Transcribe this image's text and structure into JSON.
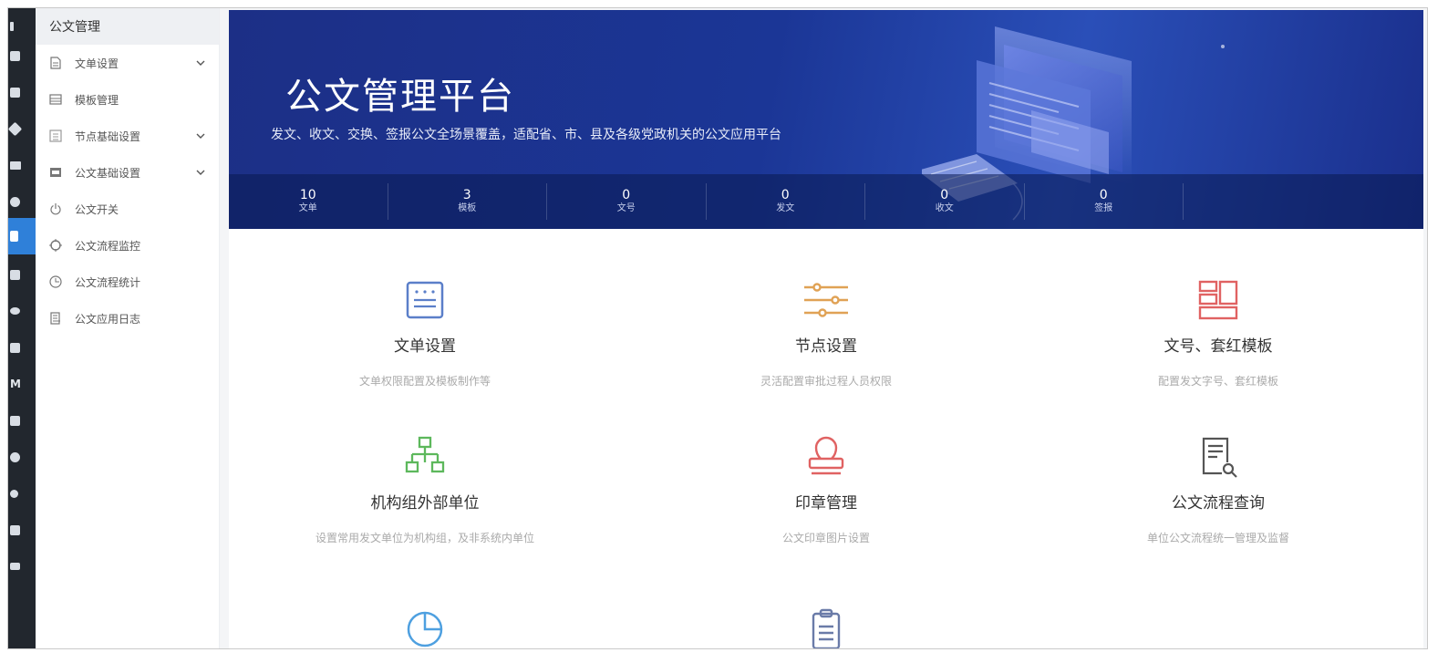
{
  "sidebar": {
    "header": "公文管理",
    "items": [
      {
        "label": "文单设置",
        "icon": "document-icon",
        "expandable": true
      },
      {
        "label": "模板管理",
        "icon": "template-icon",
        "expandable": false
      },
      {
        "label": "节点基础设置",
        "icon": "node-icon",
        "expandable": true
      },
      {
        "label": "公文基础设置",
        "icon": "settings-box-icon",
        "expandable": true
      },
      {
        "label": "公文开关",
        "icon": "power-icon",
        "expandable": false
      },
      {
        "label": "公文流程监控",
        "icon": "monitor-icon",
        "expandable": false
      },
      {
        "label": "公文流程统计",
        "icon": "clock-chart-icon",
        "expandable": false
      },
      {
        "label": "公文应用日志",
        "icon": "log-icon",
        "expandable": false
      }
    ]
  },
  "rail": {
    "active_index": 6,
    "letter": "M"
  },
  "banner": {
    "title": "公文管理平台",
    "subtitle": "发文、收文、交换、签报公文全场景覆盖，适配省、市、县及各级党政机关的公文应用平台",
    "stats": [
      {
        "value": "10",
        "label": "文单"
      },
      {
        "value": "3",
        "label": "模板"
      },
      {
        "value": "0",
        "label": "文号"
      },
      {
        "value": "0",
        "label": "发文"
      },
      {
        "value": "0",
        "label": "收文"
      },
      {
        "value": "0",
        "label": "签报"
      }
    ]
  },
  "cards": [
    {
      "title": "文单设置",
      "desc": "文单权限配置及模板制作等",
      "icon": "form-icon",
      "color": "#5b7fc9"
    },
    {
      "title": "节点设置",
      "desc": "灵活配置审批过程人员权限",
      "icon": "sliders-icon",
      "color": "#e0a255"
    },
    {
      "title": "文号、套红模板",
      "desc": "配置发文字号、套红模板",
      "icon": "layout-icon",
      "color": "#e06262"
    },
    {
      "title": "机构组外部单位",
      "desc": "设置常用发文单位为机构组，及非系统内单位",
      "icon": "org-tree-icon",
      "color": "#5db85c"
    },
    {
      "title": "印章管理",
      "desc": "公文印章图片设置",
      "icon": "seal-icon",
      "color": "#e06262"
    },
    {
      "title": "公文流程查询",
      "desc": "单位公文流程统一管理及监督",
      "icon": "doc-search-icon",
      "color": "#555555"
    },
    {
      "title": "",
      "desc": "",
      "icon": "pie-chart-icon",
      "color": "#4ea0e0"
    },
    {
      "title": "",
      "desc": "",
      "icon": "clipboard-icon",
      "color": "#6a7ba8"
    }
  ]
}
